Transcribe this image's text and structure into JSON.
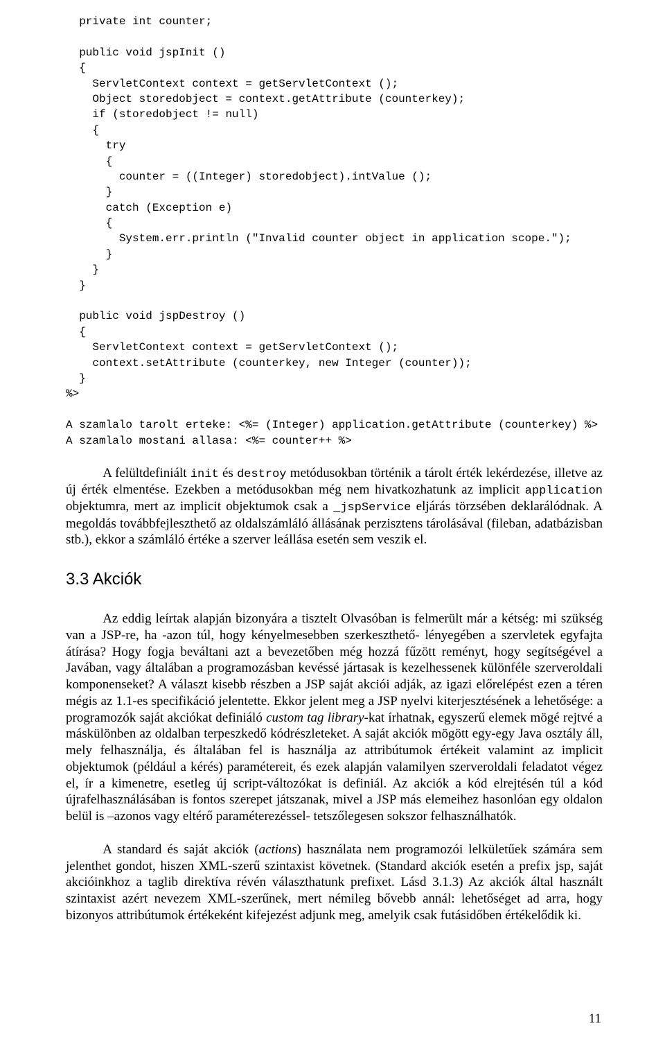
{
  "code": "  private int counter;\n\n  public void jspInit ()\n  {\n    ServletContext context = getServletContext ();\n    Object storedobject = context.getAttribute (counterkey);\n    if (storedobject != null)\n    {\n      try\n      {\n        counter = ((Integer) storedobject).intValue ();\n      }\n      catch (Exception e)\n      {\n        System.err.println (\"Invalid counter object in application scope.\");\n      }\n    }\n  }\n\n  public void jspDestroy ()\n  {\n    ServletContext context = getServletContext ();\n    context.setAttribute (counterkey, new Integer (counter));\n  }\n%>\n\nA szamlalo tarolt erteke: <%= (Integer) application.getAttribute (counterkey) %>\nA szamlalo mostani allasa: <%= counter++ %>",
  "para1": {
    "t1": "A felültdefiniált ",
    "c1": "init",
    "t2": " és ",
    "c2": "destroy",
    "t3": " metódusokban történik a tárolt érték lekérdezése, illetve az új érték elmentése. Ezekben a metódusokban még nem hivatkozhatunk az implicit ",
    "c3": "application",
    "t4": " objektumra, mert az implicit objektumok csak a ",
    "c4": "_jspService",
    "t5": " eljárás törzsében deklarálódnak. A megoldás továbbfejleszthető az oldalszámláló állásának perzisztens tárolásával (fileban, adatbázisban stb.), ekkor a számláló értéke a szerver leállása esetén sem veszik el."
  },
  "heading": "3.3 Akciók",
  "para2": {
    "t1": "Az eddig leírtak alapján bizonyára a tisztelt Olvasóban is felmerült már a kétség: mi szükség van a JSP-re, ha -azon túl, hogy kényelmesebben szerkeszthető- lényegében a szervletek egyfajta átírása? Hogy fogja beváltani azt a bevezetőben még hozzá fűzött reményt, hogy segítségével a Javában, vagy általában a programozásban kevéssé jártasak is kezelhessenek különféle szerveroldali komponenseket? A választ kisebb részben a JSP saját akciói adják, az igazi előrelépést ezen a téren mégis az 1.1-es specifikáció jelentette. Ekkor jelent meg a JSP nyelvi kiterjesztésének a lehetősége: a programozók saját akciókat definiáló ",
    "i1": "custom tag library",
    "t2": "-kat írhatnak, egyszerű elemek mögé rejtvé a máskülönben az oldalban terpeszkedő kódrészleteket. A saját akciók mögött egy-egy Java osztály áll, mely felhasználja, és általában fel is használja az attribútumok értékeit valamint az implicit objektumok (például a kérés) paramétereit, és ezek alapján valamilyen szerveroldali feladatot végez el, ír a kimenetre, esetleg új script-változókat is definiál. Az akciók a kód elrejtésén túl a kód újrafelhasználásában is fontos szerepet játszanak, mivel a JSP más elemeihez hasonlóan egy oldalon belül is –azonos vagy eltérő paraméterezéssel- tetszőlegesen sokszor felhasználhatók."
  },
  "para3": {
    "t1": "A standard és saját akciók (",
    "i1": "actions",
    "t2": ") használata nem programozói lelkületűek számára sem jelenthet gondot, hiszen XML-szerű szintaxist követnek. (Standard akciók esetén a prefix jsp, saját akcióinkhoz a taglib direktíva révén választhatunk prefixet. Lásd 3.1.3) Az akciók által használt szintaxist azért nevezem XML-szerűnek, mert némileg bővebb annál: lehetőséget ad arra, hogy bizonyos attribútumok értékeként kifejezést adjunk meg, amelyik csak futásidőben értékelődik ki."
  },
  "pagenum": "11"
}
